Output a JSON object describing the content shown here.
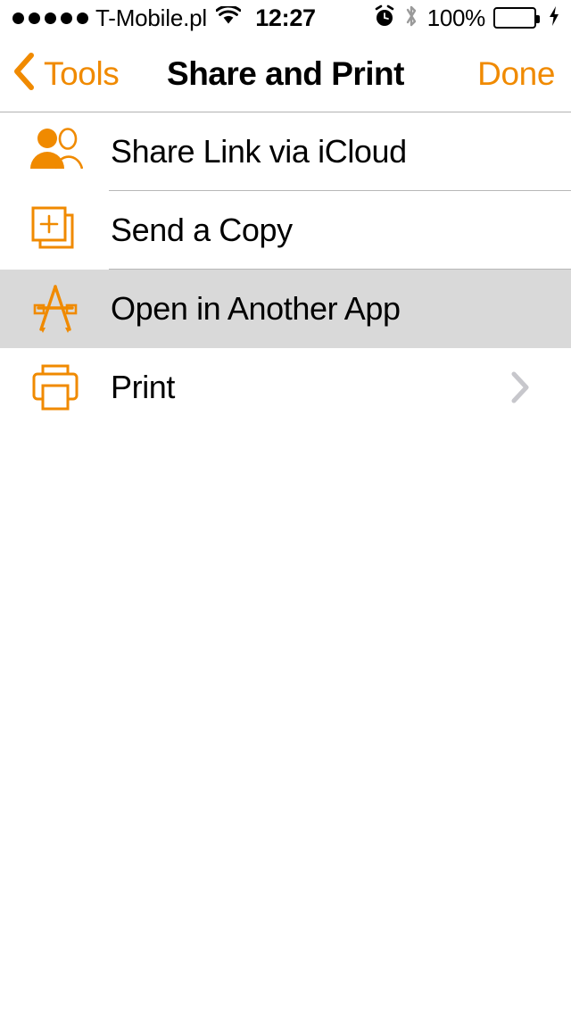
{
  "status_bar": {
    "signal_dots_filled": 5,
    "carrier": "T-Mobile.pl",
    "wifi_icon": "wifi-icon",
    "time": "12:27",
    "alarm_icon": "alarm-clock-icon",
    "bluetooth_icon": "bluetooth-icon",
    "battery_percent": "100%",
    "battery_level": 100,
    "battery_color": "#4CD964",
    "charging_icon": "lightning-bolt-icon"
  },
  "nav_bar": {
    "back_icon": "chevron-left-icon",
    "back_label": "Tools",
    "title": "Share and Print",
    "done_label": "Done",
    "accent_color": "#F08A00"
  },
  "list": {
    "selected_index": 2,
    "selected_color": "#d9d9d9",
    "separator_color": "#b8b8b8",
    "items": [
      {
        "label": "Share Link via iCloud",
        "icon": "two-people-icon",
        "has_chevron": false,
        "selected": false
      },
      {
        "label": "Send a Copy",
        "icon": "copy-plus-icon",
        "has_chevron": false,
        "selected": false
      },
      {
        "label": "Open in Another App",
        "icon": "app-store-icon",
        "has_chevron": false,
        "selected": true
      },
      {
        "label": "Print",
        "icon": "printer-icon",
        "has_chevron": true,
        "selected": false
      }
    ]
  }
}
